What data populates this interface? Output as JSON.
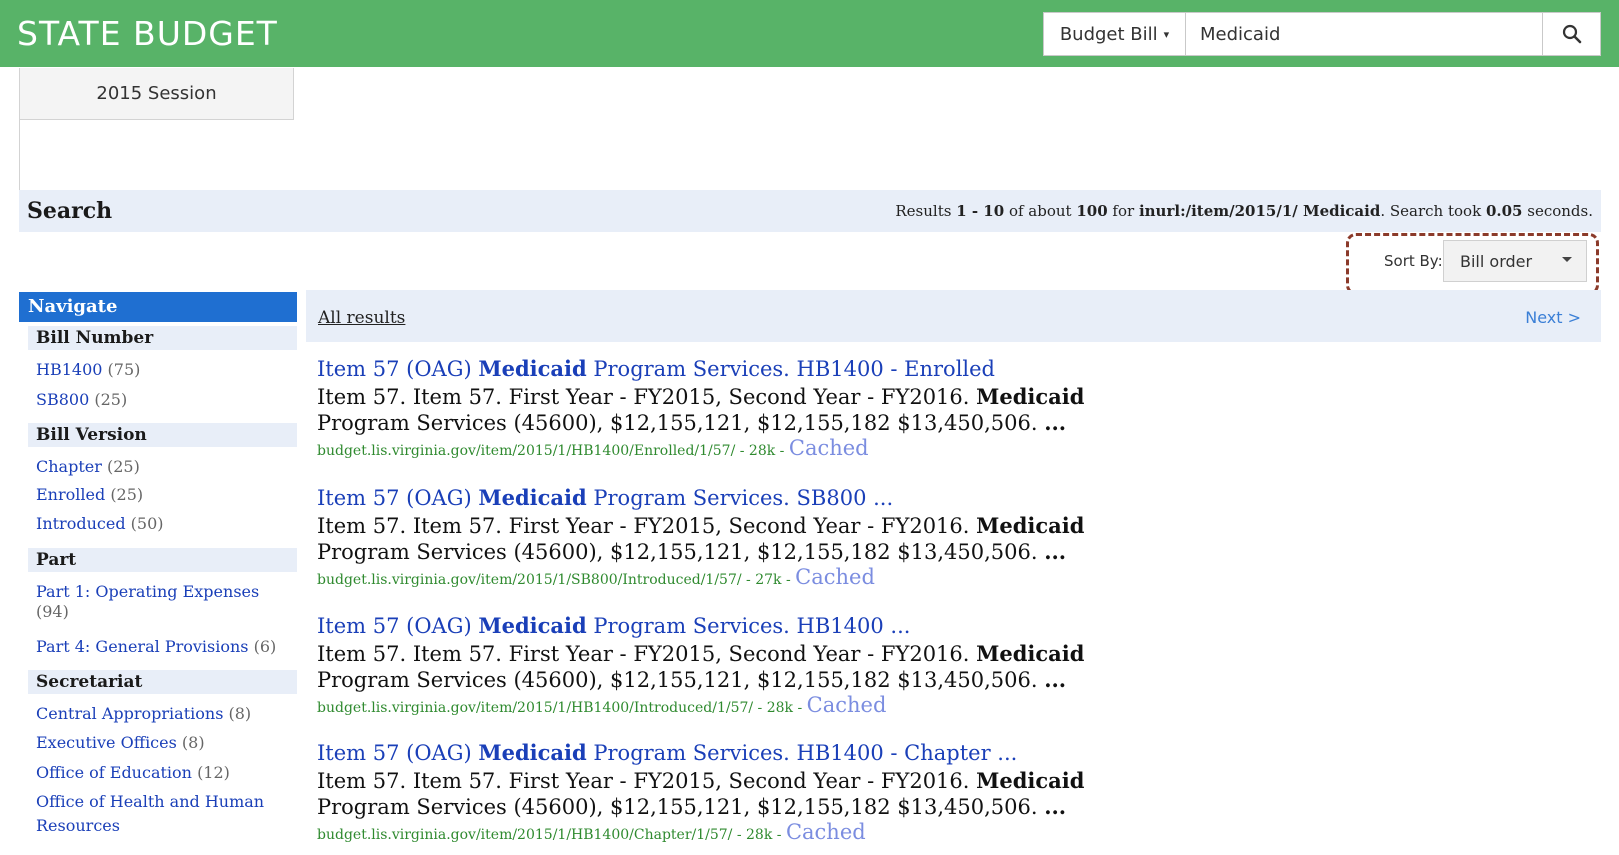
{
  "header": {
    "brand": "STATE BUDGET",
    "scope_label": "Budget Bill",
    "search_value": "Medicaid",
    "search_icon": "search-icon"
  },
  "session_button": "2015 Session",
  "search_header": {
    "title": "Search",
    "summary_prefix": "Results ",
    "summary_range": "1 - 10",
    "summary_of": " of about ",
    "summary_total": "100",
    "summary_for": " for ",
    "summary_query": "inurl:/item/2015/1/ Medicaid",
    "summary_took": ". Search took ",
    "summary_time": "0.05",
    "summary_seconds": " seconds."
  },
  "sort": {
    "label": "Sort By:",
    "selected": "Bill order"
  },
  "sidebar": {
    "title": "Navigate",
    "sections": [
      {
        "heading": "Bill Number",
        "items": [
          {
            "label": "HB1400",
            "count": "(75)"
          },
          {
            "label": "SB800",
            "count": "(25)"
          }
        ]
      },
      {
        "heading": "Bill Version",
        "items": [
          {
            "label": "Chapter",
            "count": "(25)"
          },
          {
            "label": "Enrolled",
            "count": "(25)"
          },
          {
            "label": "Introduced",
            "count": "(50)"
          }
        ]
      },
      {
        "heading": "Part",
        "items": [
          {
            "label": "Part 1: Operating Expenses",
            "count": "(94)"
          },
          {
            "label": "Part 4: General Provisions",
            "count": "(6)"
          }
        ]
      },
      {
        "heading": "Secretariat",
        "items": [
          {
            "label": "Central Appropriations",
            "count": "(8)"
          },
          {
            "label": "Executive Offices",
            "count": "(8)"
          },
          {
            "label": "Office of Education",
            "count": "(12)"
          },
          {
            "label": "Office of Health and Human Resources",
            "count": ""
          }
        ]
      }
    ]
  },
  "results_bar": {
    "all_results": "All results",
    "next": "Next >"
  },
  "results": [
    {
      "title_pre": "Item 57 (OAG) ",
      "title_bold": "Medicaid",
      "title_post": " Program Services. HB1400 - Enrolled",
      "snippet_pre": "Item 57. Item 57. First Year - FY2015, Second Year - FY2016. ",
      "snippet_bold": "Medicaid",
      "snippet_post": " Program Services (45600), $12,155,121, $12,155,182 $13,450,506. ",
      "snippet_end": "...",
      "url": "budget.lis.virginia.gov/item/2015/1/HB1400/Enrolled/1/57/ - 28k - ",
      "cached": "Cached"
    },
    {
      "title_pre": "Item 57 (OAG) ",
      "title_bold": "Medicaid",
      "title_post": " Program Services. SB800 ...",
      "snippet_pre": "Item 57. Item 57. First Year - FY2015, Second Year - FY2016. ",
      "snippet_bold": "Medicaid",
      "snippet_post": " Program Services (45600), $12,155,121, $12,155,182 $13,450,506. ",
      "snippet_end": "...",
      "url": "budget.lis.virginia.gov/item/2015/1/SB800/Introduced/1/57/ - 27k - ",
      "cached": "Cached"
    },
    {
      "title_pre": "Item 57 (OAG) ",
      "title_bold": "Medicaid",
      "title_post": " Program Services. HB1400 ...",
      "snippet_pre": "Item 57. Item 57. First Year - FY2015, Second Year - FY2016. ",
      "snippet_bold": "Medicaid",
      "snippet_post": " Program Services (45600), $12,155,121, $12,155,182 $13,450,506. ",
      "snippet_end": "...",
      "url": "budget.lis.virginia.gov/item/2015/1/HB1400/Introduced/1/57/ - 28k - ",
      "cached": "Cached"
    },
    {
      "title_pre": "Item 57 (OAG) ",
      "title_bold": "Medicaid",
      "title_post": " Program Services. HB1400 - Chapter ...",
      "snippet_pre": "Item 57. Item 57. First Year - FY2015, Second Year - FY2016. ",
      "snippet_bold": "Medicaid",
      "snippet_post": " Program Services (45600), $12,155,121, $12,155,182 $13,450,506. ",
      "snippet_end": "...",
      "url": "budget.lis.virginia.gov/item/2015/1/HB1400/Chapter/1/57/ - 28k - ",
      "cached": "Cached"
    }
  ]
}
